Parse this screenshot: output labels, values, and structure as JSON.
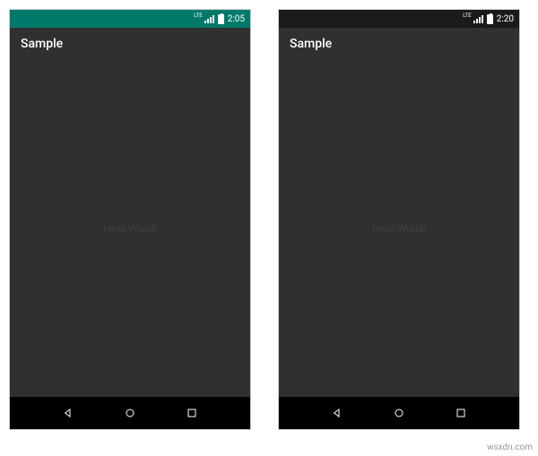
{
  "phones": [
    {
      "status_bar_color": "teal",
      "network_label": "LTE",
      "time": "2:05",
      "app_title": "Sample",
      "content_text": "Hello World!"
    },
    {
      "status_bar_color": "dark",
      "network_label": "LTE",
      "time": "2:20",
      "app_title": "Sample",
      "content_text": "Hello World!"
    }
  ],
  "watermark": "wsxdn.com"
}
